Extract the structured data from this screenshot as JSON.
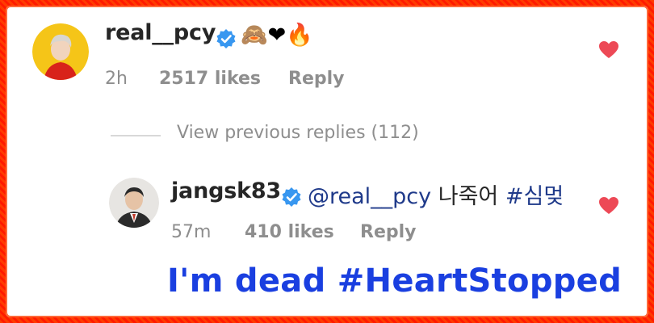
{
  "comment1": {
    "username": "real__pcy",
    "emojis": "🙈❤🔥",
    "time": "2h",
    "likes": "2517 likes",
    "reply": "Reply"
  },
  "view_previous": "View previous replies (112)",
  "comment2": {
    "username": "jangsk83",
    "mention": "@real__pcy",
    "text": "나죽어",
    "hashtag": "#심멎",
    "time": "57m",
    "likes": "410 likes",
    "reply": "Reply"
  },
  "caption": "I'm dead #HeartStopped",
  "colors": {
    "frame": "#ff2a00",
    "verified": "#3897f0",
    "heart": "#ed4956",
    "caption": "#1a3fe0",
    "mention": "#1f3a8a"
  }
}
